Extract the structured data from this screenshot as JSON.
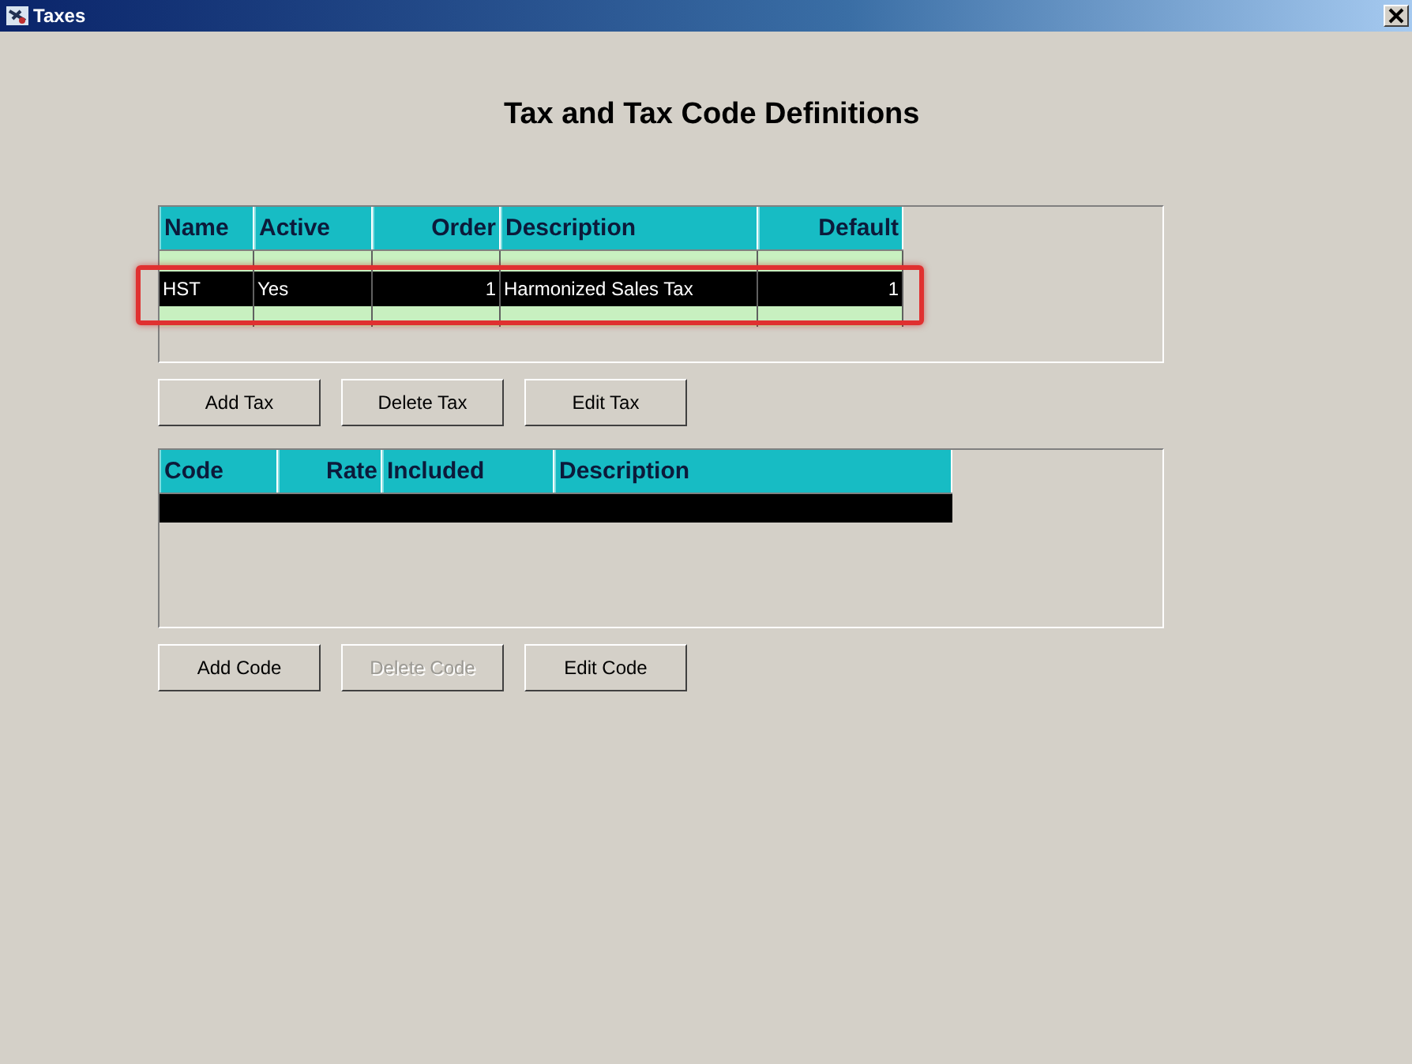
{
  "window": {
    "title": "Taxes"
  },
  "heading": "Tax and Tax Code Definitions",
  "tax_table": {
    "columns": [
      {
        "label": "Name"
      },
      {
        "label": "Active"
      },
      {
        "label": "Order"
      },
      {
        "label": "Description"
      },
      {
        "label": "Default"
      }
    ],
    "rows": [
      {
        "selected": false
      },
      {
        "selected": true,
        "cells": [
          "HST",
          "Yes",
          "1",
          "Harmonized Sales Tax",
          "1"
        ]
      },
      {
        "selected": false
      }
    ],
    "highlighted": true
  },
  "tax_buttons": [
    {
      "label": "Add Tax",
      "disabled": false
    },
    {
      "label": "Delete Tax",
      "disabled": false
    },
    {
      "label": "Edit Tax",
      "disabled": false
    }
  ],
  "code_table": {
    "columns": [
      {
        "label": "Code"
      },
      {
        "label": "Rate"
      },
      {
        "label": "Included"
      },
      {
        "label": "Description"
      }
    ],
    "rows": [
      {
        "selected": true
      }
    ]
  },
  "code_buttons": [
    {
      "label": "Add Code",
      "disabled": false
    },
    {
      "label": "Delete Code",
      "disabled": true
    },
    {
      "label": "Edit Code",
      "disabled": false
    }
  ]
}
